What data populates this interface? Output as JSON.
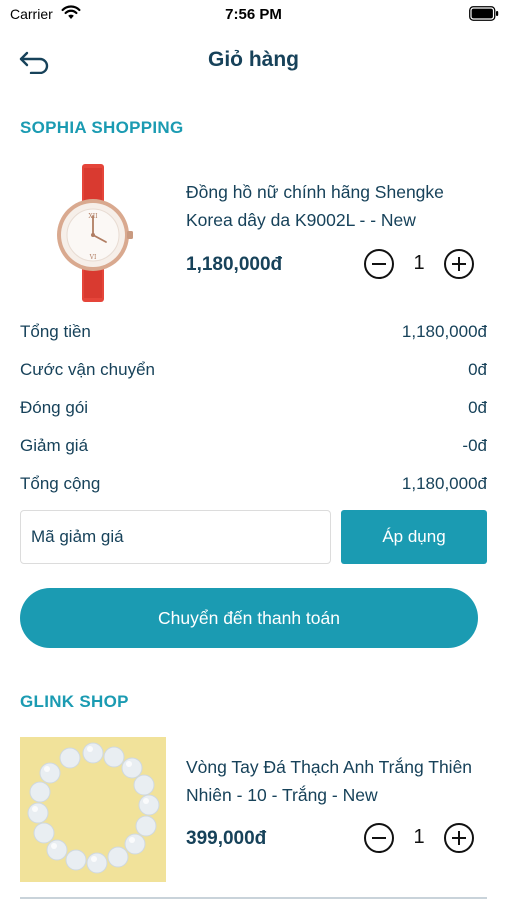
{
  "status_bar": {
    "carrier": "Carrier",
    "time": "7:56 PM"
  },
  "nav": {
    "title": "Giỏ hàng"
  },
  "shops": [
    {
      "name": "SOPHIA SHOPPING",
      "product": {
        "title": "Đồng hồ nữ chính hãng Shengke Korea dây da K9002L - - New",
        "price": "1,180,000đ",
        "quantity": "1",
        "image_icon": "watch-image"
      }
    },
    {
      "name": "GLINK SHOP",
      "product": {
        "title": "Vòng Tay Đá Thạch Anh Trắng Thiên Nhiên - 10 - Trắng - New",
        "price": "399,000đ",
        "quantity": "1",
        "image_icon": "bracelet-image"
      }
    }
  ],
  "summary": [
    {
      "label": "Tổng tiền",
      "value": "1,180,000đ"
    },
    {
      "label": "Cước vận chuyển",
      "value": "0đ"
    },
    {
      "label": "Đóng gói",
      "value": "0đ"
    },
    {
      "label": "Giảm giá",
      "value": "-0đ"
    },
    {
      "label": "Tổng cộng",
      "value": "1,180,000đ"
    }
  ],
  "coupon": {
    "placeholder": "Mã giảm giá",
    "value": "",
    "apply_label": "Áp dụng"
  },
  "checkout": {
    "label": "Chuyển đến thanh toán"
  },
  "colors": {
    "accent": "#1b9bb2",
    "text": "#17425a"
  }
}
